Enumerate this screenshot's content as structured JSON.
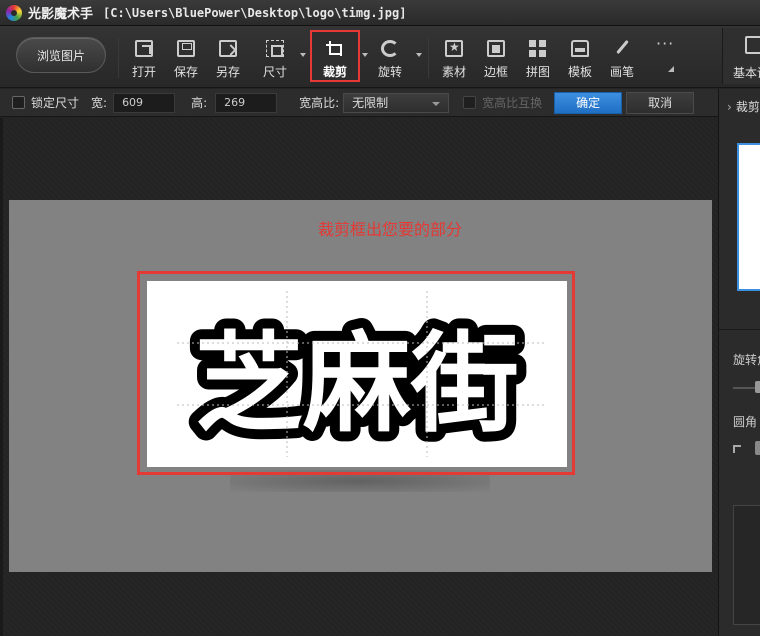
{
  "titlebar": {
    "app_name": "光影魔术手",
    "file_path": "[C:\\Users\\BluePower\\Desktop\\logo\\timg.jpg]"
  },
  "toolbar": {
    "browse_label": "浏览图片",
    "tools": [
      {
        "id": "open",
        "label": "打开",
        "icon": "open-icon"
      },
      {
        "id": "save",
        "label": "保存",
        "icon": "save-icon"
      },
      {
        "id": "saveas",
        "label": "另存",
        "icon": "save-as-icon"
      },
      {
        "id": "size",
        "label": "尺寸",
        "icon": "resize-icon"
      },
      {
        "id": "crop",
        "label": "裁剪",
        "icon": "crop-icon",
        "active": true
      },
      {
        "id": "rotate",
        "label": "旋转",
        "icon": "rotate-icon"
      },
      {
        "id": "material",
        "label": "素材",
        "icon": "star-icon"
      },
      {
        "id": "border",
        "label": "边框",
        "icon": "frame-icon"
      },
      {
        "id": "collage",
        "label": "拼图",
        "icon": "grid-icon"
      },
      {
        "id": "template",
        "label": "模板",
        "icon": "printer-icon"
      },
      {
        "id": "brush",
        "label": "画笔",
        "icon": "brush-icon"
      }
    ],
    "more_icon": "more-icon",
    "basic_label": "基本调"
  },
  "options": {
    "lock_size_label": "锁定尺寸",
    "width_label": "宽:",
    "width_value": "609",
    "height_label": "高:",
    "height_value": "269",
    "ratio_label": "宽高比:",
    "ratio_value": "无限制",
    "swap_label": "宽高比互换",
    "ok_label": "确定",
    "cancel_label": "取消"
  },
  "canvas": {
    "hint": "裁剪框出您要的部分",
    "logo_text": "芝麻街",
    "accent_color": "#e53935"
  },
  "right_panel": {
    "tab_label": "裁剪",
    "rotate_label": "旋转角",
    "corner_label": "圆角"
  }
}
